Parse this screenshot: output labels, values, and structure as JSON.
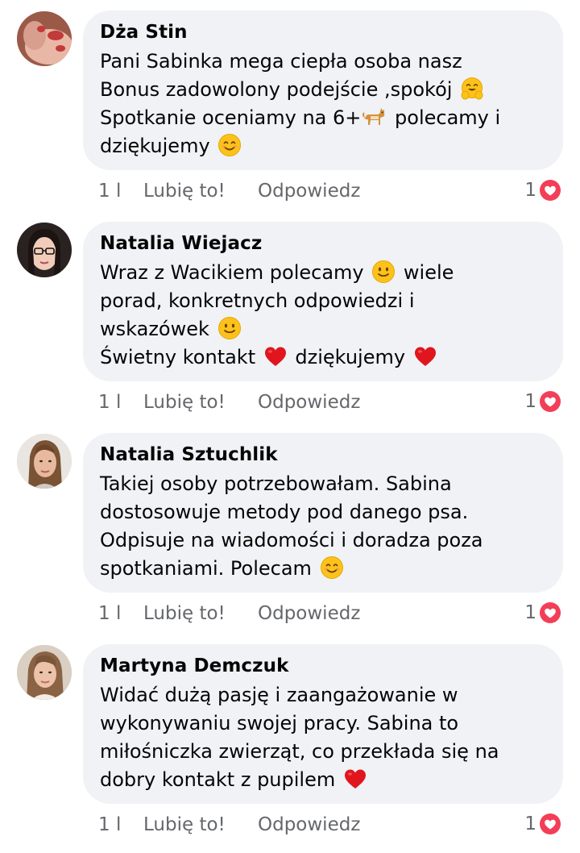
{
  "colors": {
    "bubble_bg": "#f0f2f5",
    "meta_text": "#65676b",
    "heart": "#f33e58"
  },
  "comments": [
    {
      "author": "Dża Stin",
      "lines": [
        "Pani Sabinka mega ciepła osoba nasz",
        "Bonus zadowolony podejście ,spokój",
        "Spotkanie oceniamy na 6+",
        " polecamy i",
        "dziękujemy"
      ],
      "age": "1 l",
      "like_label": "Lubię to!",
      "reply_label": "Odpowiedz",
      "reaction_count": "1",
      "reaction_icon": "heart-icon"
    },
    {
      "author": "Natalia Wiejacz",
      "lines": [
        "Wraz z Wacikiem polecamy",
        "wiele",
        "porad, konkretnych odpowiedzi i",
        "wskazówek",
        "Świetny kontakt",
        "dziękujemy"
      ],
      "age": "1 l",
      "like_label": "Lubię to!",
      "reply_label": "Odpowiedz",
      "reaction_count": "1",
      "reaction_icon": "heart-icon"
    },
    {
      "author": "Natalia Sztuchlik",
      "lines": [
        "Takiej osoby potrzebowałam. Sabina",
        "dostosowuje metody pod danego psa.",
        "Odpisuje na wiadomości i doradza poza",
        "spotkaniami. Polecam"
      ],
      "age": "1 l",
      "like_label": "Lubię to!",
      "reply_label": "Odpowiedz",
      "reaction_count": "1",
      "reaction_icon": "heart-icon"
    },
    {
      "author": "Martyna Demczuk",
      "lines": [
        "Widać dużą pasję i zaangażowanie w",
        "wykonywaniu swojej pracy. Sabina to",
        "miłośniczka zwierząt, co przekłada się na",
        "dobry kontakt z pupilem"
      ],
      "age": "1 l",
      "like_label": "Lubię to!",
      "reply_label": "Odpowiedz",
      "reaction_count": "1",
      "reaction_icon": "heart-icon"
    }
  ]
}
